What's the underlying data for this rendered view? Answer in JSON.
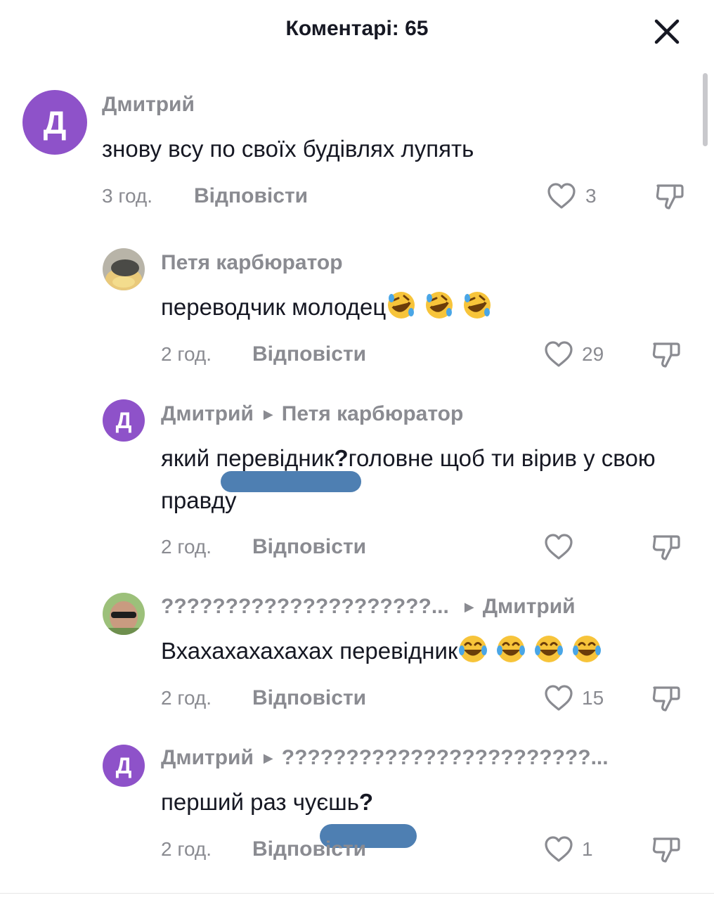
{
  "header": {
    "title": "Коментарі: 65",
    "close_icon": "close-icon"
  },
  "colors": {
    "avatar_purple": "#8e52c9",
    "muted": "#8a8b91",
    "text": "#161823",
    "scribble": "#4e7fb2"
  },
  "comments": [
    {
      "avatar_letter": "Д",
      "author": "Дмитрий",
      "text": "знову всу по своїх будівлях лупять",
      "time": "3 год.",
      "reply_label": "Відповісти",
      "likes": "3"
    },
    {
      "avatar_icon": "user-photo-icon",
      "author": "Петя карбюратор",
      "text": "переводчик молодец",
      "emoji_icon": "rofl-emoji-icon",
      "emoji_count": 3,
      "time": "2 год.",
      "reply_label": "Відповісти",
      "likes": "29"
    },
    {
      "avatar_letter": "Д",
      "author": "Дмитрий",
      "reply_to": "Петя карбюратор",
      "text": "який перевідник",
      "text_mark": "?",
      "text_rest": "головне щоб ти вірив у свою правду",
      "time": "2 год.",
      "reply_label": "Відповісти",
      "likes": ""
    },
    {
      "avatar_icon": "user-photo-icon",
      "author": "?????????????????????...",
      "reply_to": "Дмитрий",
      "text": "Вхахахахахахах перевідник",
      "emoji_icon": "joy-emoji-icon",
      "emoji_count": 4,
      "time": "2 год.",
      "reply_label": "Відповісти",
      "likes": "15"
    },
    {
      "avatar_letter": "Д",
      "author": "Дмитрий",
      "reply_to": "????????????????????????...",
      "text": "перший раз чуєшь",
      "text_mark": "?",
      "time": "2 год.",
      "reply_label": "Відповісти",
      "likes": "1"
    }
  ]
}
